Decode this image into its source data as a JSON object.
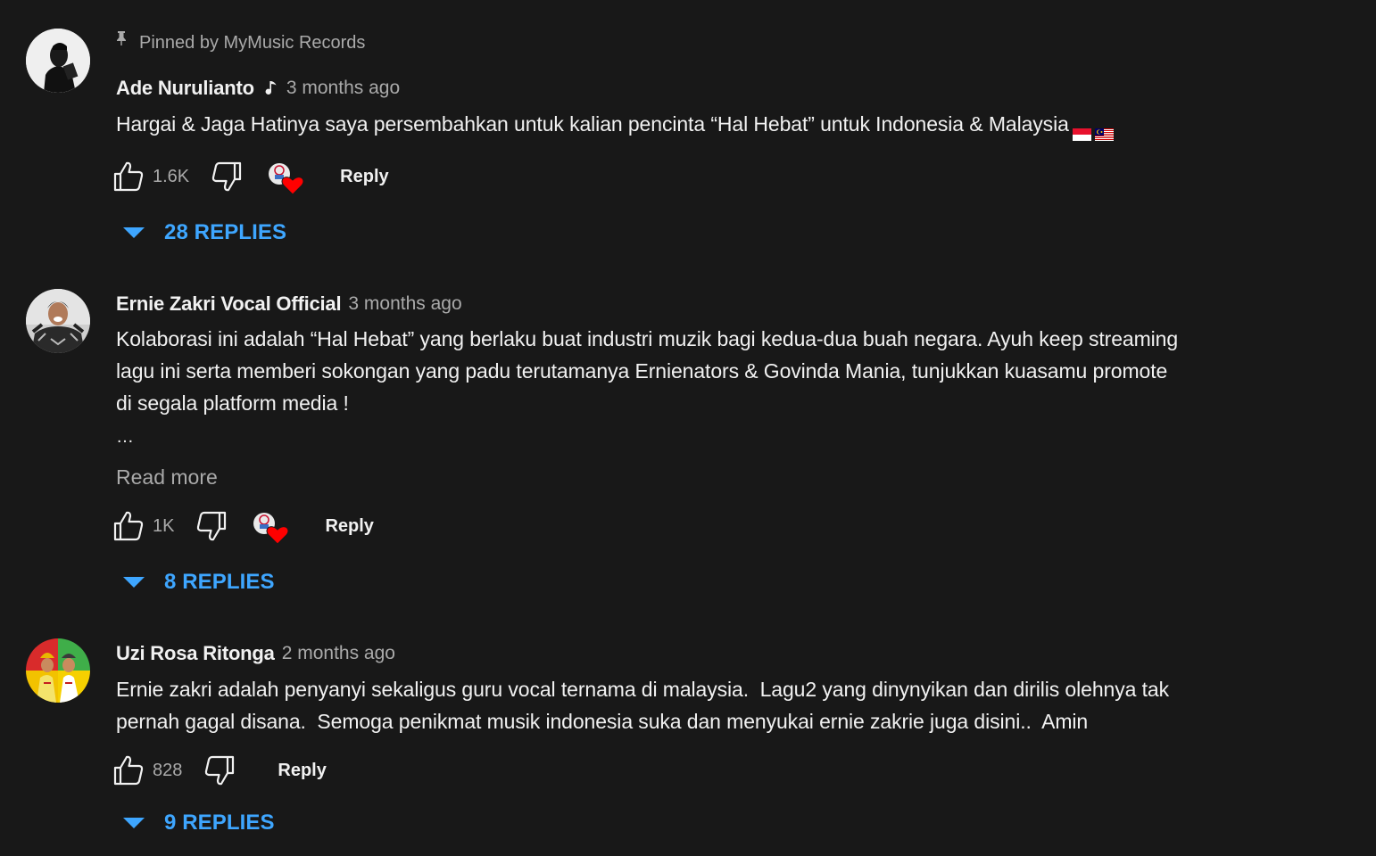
{
  "comments": [
    {
      "pinned_label": "Pinned by MyMusic Records",
      "author": "Ade Nurulianto",
      "time": "3 months ago",
      "text_lines": [
        "Hargai & Jaga Hatinya saya persembahkan untuk kalian pencinta “Hal Hebat” untuk Indonesia & Malaysia"
      ],
      "likes": "1.6K",
      "reply_label": "Reply",
      "replies_label": "28 REPLIES"
    },
    {
      "author": "Ernie Zakri Vocal Official",
      "time": "3 months ago",
      "text_lines": [
        "Kolaborasi ini adalah “Hal Hebat” yang berlaku buat industri muzik bagi kedua-dua buah negara. Ayuh keep streaming",
        "lagu ini serta memberi sokongan yang padu terutamanya Ernienators & Govinda Mania, tunjukkan kuasamu promote",
        "di segala platform media !"
      ],
      "ellipsis": "…",
      "read_more": "Read more",
      "likes": "1K",
      "reply_label": "Reply",
      "replies_label": "8 REPLIES"
    },
    {
      "author": "Uzi Rosa Ritonga",
      "time": "2 months ago",
      "text_lines": [
        "Ernie zakri adalah penyanyi sekaligus guru vocal ternama di malaysia.  Lagu2 yang dinynyikan dan dirilis olehnya tak",
        "pernah gagal disana.  Semoga penikmat musik indonesia suka dan menyukai ernie zakrie juga disini..  Amin"
      ],
      "likes": "828",
      "reply_label": "Reply",
      "replies_label": "9 REPLIES"
    }
  ],
  "colors": {
    "background": "#181818",
    "text_primary": "#f1f1f1",
    "text_secondary": "#aaaaaa",
    "link_blue": "#3ea6ff",
    "heart_red": "#ff0000"
  },
  "icons": {
    "pin": "pin-icon",
    "music_note": "music-note-icon",
    "like": "thumbs-up-icon",
    "dislike": "thumbs-down-icon",
    "creator_heart": "creator-heart-icon",
    "expand": "caret-down-icon"
  }
}
